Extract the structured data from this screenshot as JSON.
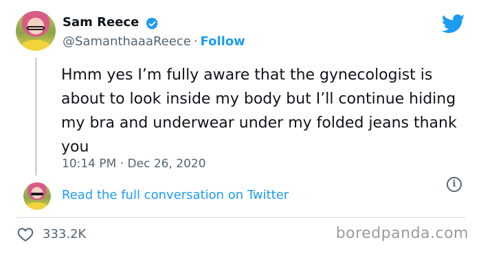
{
  "tweet": {
    "author_name": "Sam Reece",
    "handle": "@SamanthaaaReece",
    "separator": "·",
    "follow_label": "Follow",
    "text": "Hmm yes I’m fully aware that the gynecologist is about to look inside my body but I’ll continue hiding my bra and underwear under my folded jeans thank you",
    "timestamp": "10:14 PM · Dec 26, 2020",
    "info_symbol": "i",
    "read_more_label": "Read the full conversation on Twitter",
    "like_count": "333.2K"
  },
  "watermark": "boredpanda.com",
  "icons": {
    "verified": "verified-badge-icon",
    "logo": "twitter-bird-icon",
    "like": "heart-icon",
    "info": "info-icon"
  },
  "colors": {
    "accent": "#1d9bf0",
    "text_primary": "#0f1419",
    "text_secondary": "#536471",
    "divider": "#cfd9de"
  }
}
